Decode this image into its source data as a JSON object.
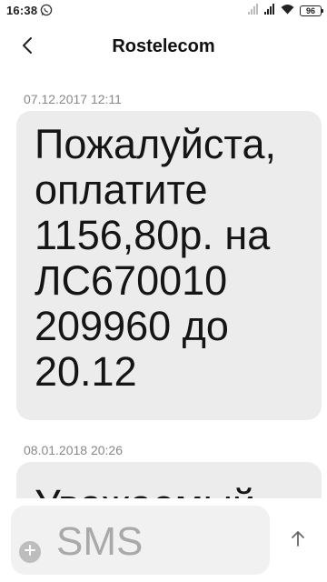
{
  "status_bar": {
    "time": "16:38",
    "battery": "96",
    "icons": [
      "whatsapp-icon",
      "signal-icon",
      "signal-icon",
      "wifi-icon",
      "battery-icon"
    ]
  },
  "header": {
    "title": "Rostelecom",
    "back_icon": "chevron-left-icon"
  },
  "messages": [
    {
      "timestamp": "07.12.2017 12:11",
      "lines": [
        "Пожалуйста,",
        "оплатите",
        "1156,80р. на",
        "ЛС670010",
        "209960 до",
        "20.12"
      ]
    },
    {
      "timestamp": "08.01.2018 20:26",
      "lines": [
        "Уважаемый"
      ]
    }
  ],
  "composer": {
    "placeholder": "SMS",
    "add_icon": "plus-icon",
    "send_icon": "arrow-up-icon"
  },
  "colors": {
    "bubble": "#ececec",
    "timestamp": "#888888",
    "input_bg": "#f1f1f1"
  }
}
